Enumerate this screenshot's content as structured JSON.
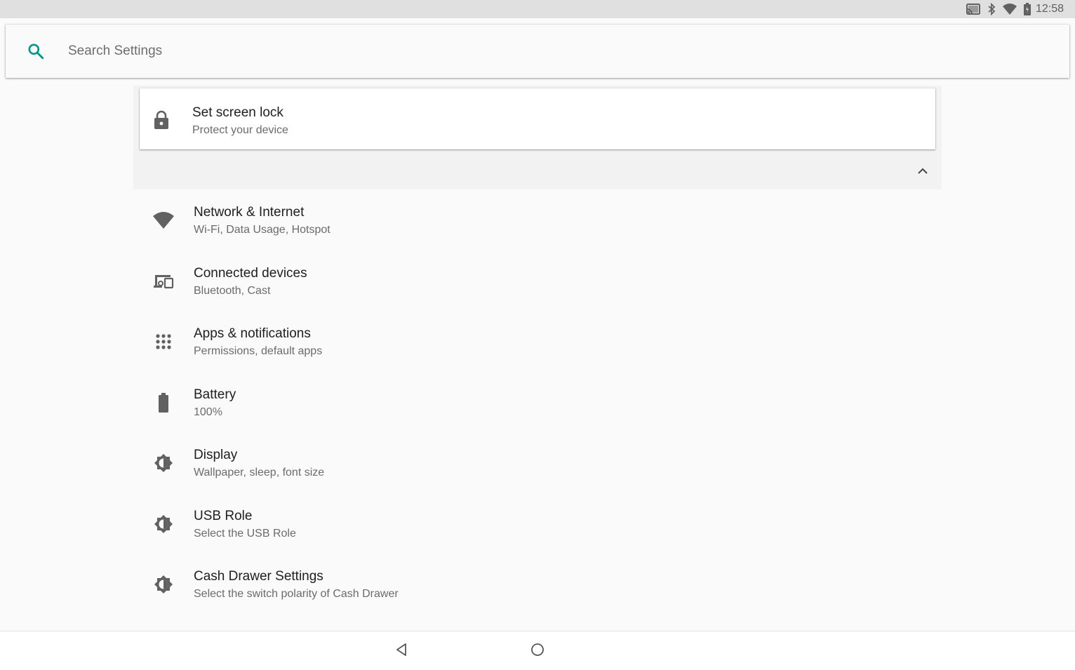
{
  "status_bar": {
    "time": "12:58",
    "icons": [
      "cast-icon",
      "bluetooth-icon",
      "wifi-icon",
      "battery-icon"
    ]
  },
  "search": {
    "placeholder": "Search Settings",
    "value": ""
  },
  "suggestion": {
    "title": "Set screen lock",
    "subtitle": "Protect your device",
    "icon": "lock-icon"
  },
  "settings": {
    "items": [
      {
        "title": "Network & Internet",
        "subtitle": "Wi-Fi, Data Usage, Hotspot",
        "icon": "wifi-icon"
      },
      {
        "title": "Connected devices",
        "subtitle": "Bluetooth, Cast",
        "icon": "devices-icon"
      },
      {
        "title": "Apps & notifications",
        "subtitle": "Permissions, default apps",
        "icon": "apps-grid-icon"
      },
      {
        "title": "Battery",
        "subtitle": "100%",
        "icon": "battery-icon"
      },
      {
        "title": "Display",
        "subtitle": "Wallpaper, sleep, font size",
        "icon": "brightness-icon"
      },
      {
        "title": "USB Role",
        "subtitle": "Select the USB Role",
        "icon": "brightness-icon"
      },
      {
        "title": "Cash Drawer Settings",
        "subtitle": "Select the switch polarity of Cash Drawer",
        "icon": "brightness-icon"
      }
    ]
  },
  "nav_bar": {
    "buttons": [
      "back-icon",
      "home-icon"
    ]
  },
  "colors": {
    "accent": "#009688",
    "icon_gray": "#616161",
    "background": "#fafafa",
    "status_bar": "#e0e0e0"
  }
}
